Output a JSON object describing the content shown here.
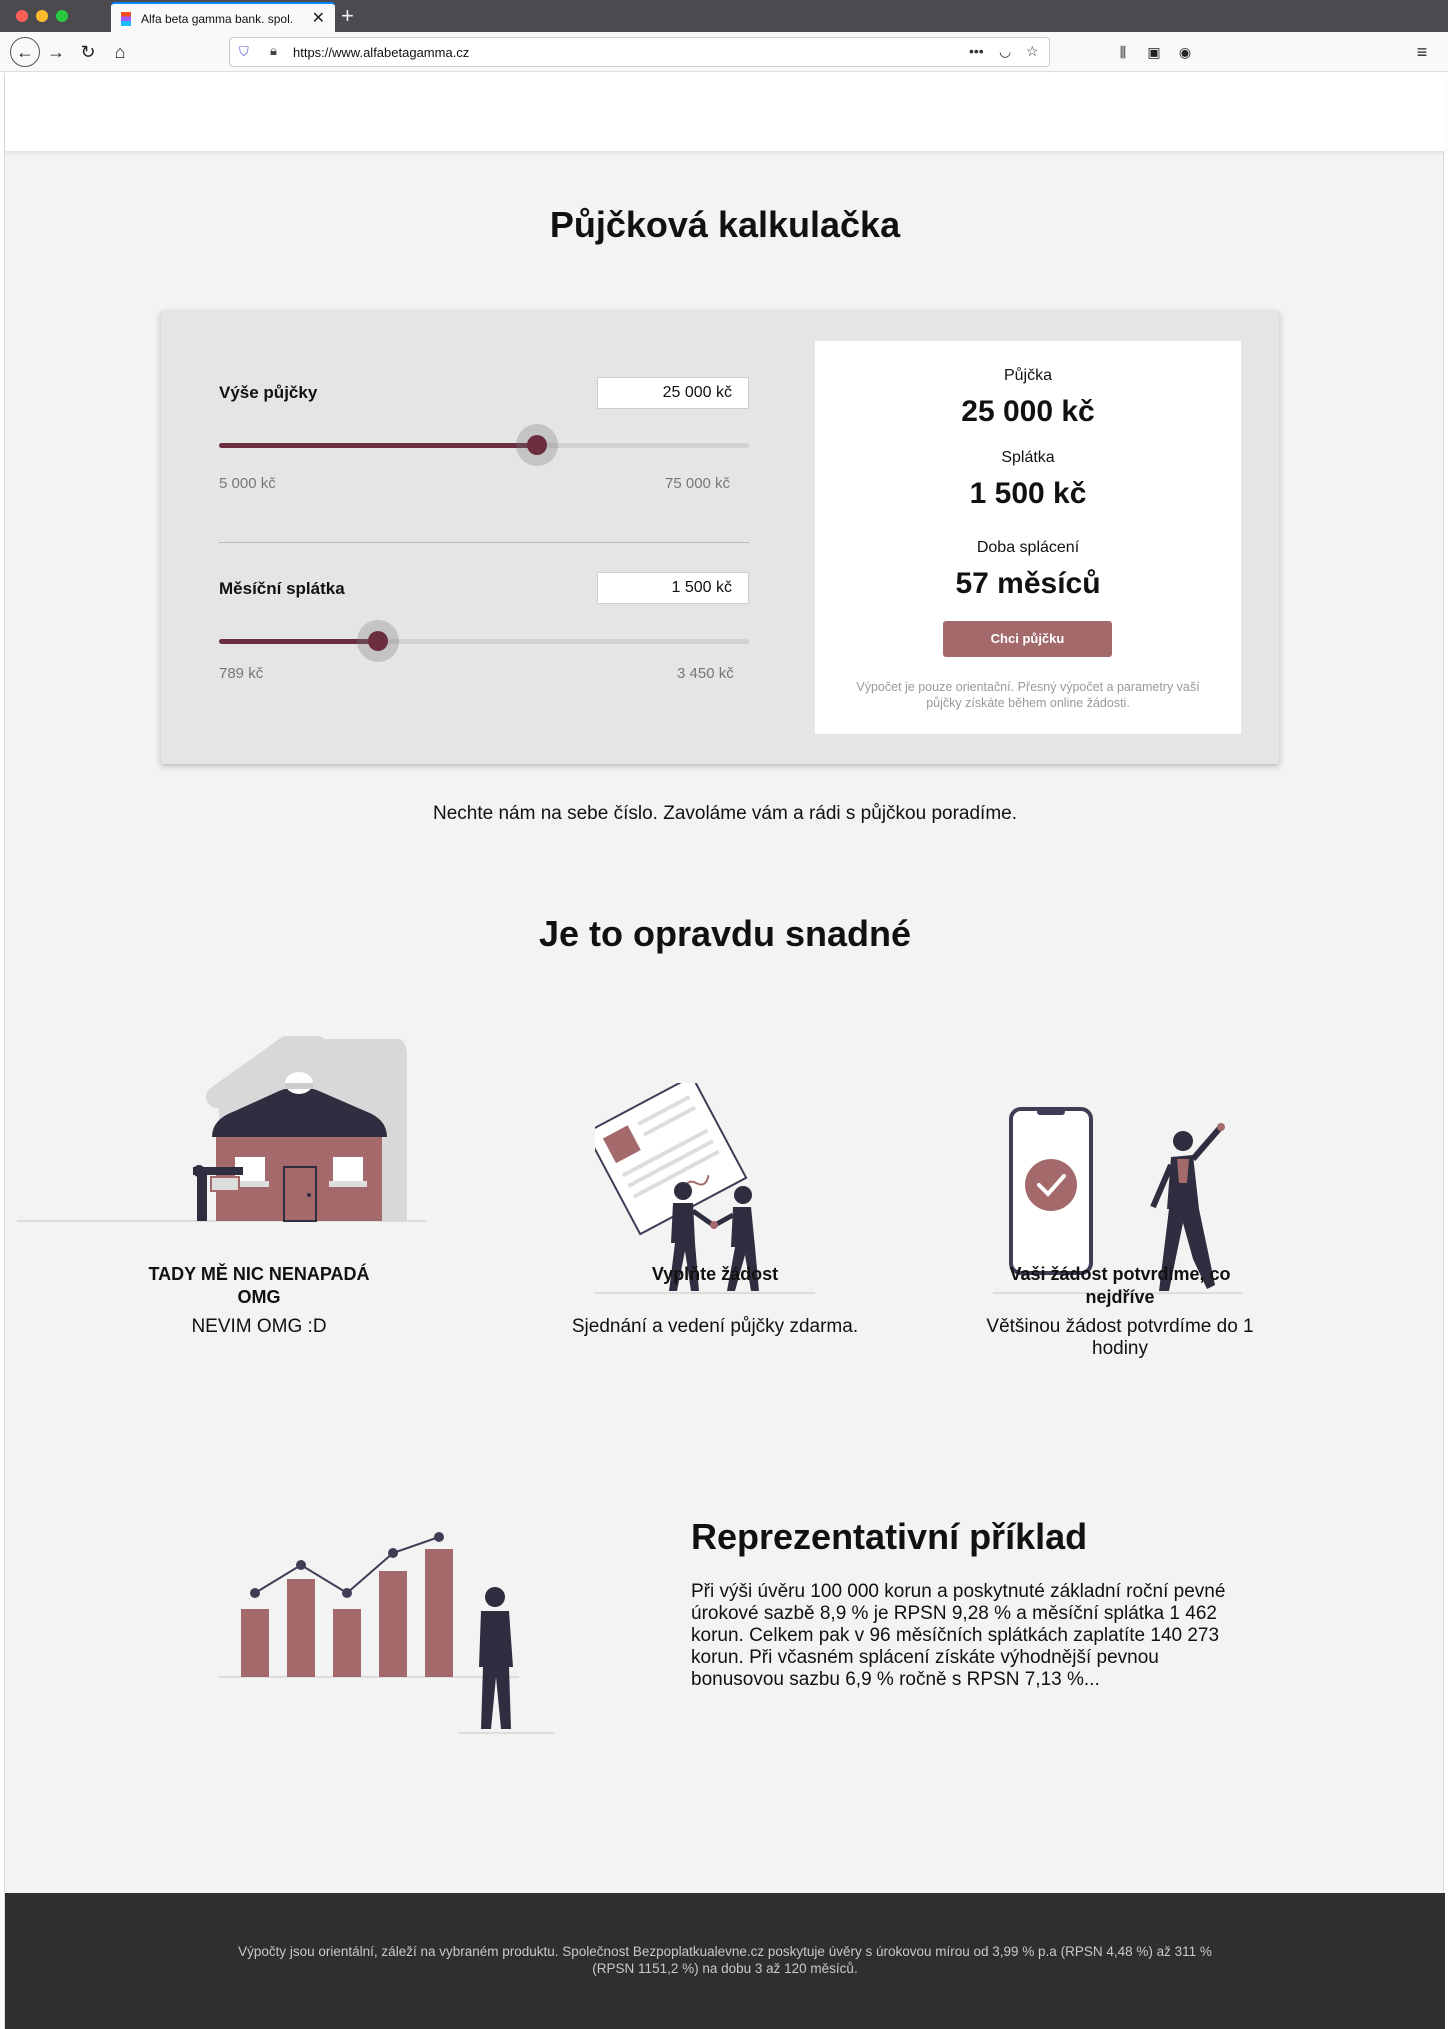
{
  "browser": {
    "tab_title": "Alfa beta gamma bank. spol.",
    "tab_close": "✕",
    "new_tab": "+",
    "url": "https://www.alfabetagamma.cz",
    "icons": [
      "back-icon",
      "forward-icon",
      "reload-icon",
      "home-icon",
      "tracking-shield-icon",
      "lock-icon",
      "page-actions-icon",
      "pocket-icon",
      "bookmark-star-icon",
      "library-icon",
      "sidebar-icon",
      "account-icon",
      "menu-icon"
    ]
  },
  "calculator": {
    "heading": "Půjčková kalkulačka",
    "amount": {
      "label": "Výše půjčky",
      "value": "25 000 kč",
      "min": "5 000 kč",
      "max": "75 000 kč",
      "level": 0.6
    },
    "payment": {
      "label": "Měsíční splátka",
      "value": "1 500 kč",
      "min": "789 kč",
      "max": "3 450 kč",
      "level": 0.3
    },
    "result": {
      "loan_label": "Půjčka",
      "loan_value": "25 000 kč",
      "payment_label": "Splátka",
      "payment_value": "1 500 kč",
      "duration_label": "Doba splácení",
      "duration_value": "57 měsíců",
      "cta": "Chci půjčku",
      "note": "Výpočet je pouze orientační. Přesný výpočet a parametry vaší půjčky získáte během online žádosti."
    },
    "callback_text": "Nechte nám na sebe číslo. Zavoláme vám a rádi s půjčkou poradíme."
  },
  "steps": {
    "heading": "Je to opravdu snadné",
    "items": [
      {
        "title": "TADY MĚ NIC NENAPADÁ OMG",
        "text": "NEVIM OMG :D"
      },
      {
        "title": "Vyplňte žádost",
        "text": "Sjednání a vedení půjčky zdarma."
      },
      {
        "title": "Vaši žádost potvrdíme, co nejdříve",
        "text": "Většinou žádost potvrdíme do 1 hodiny"
      }
    ]
  },
  "example": {
    "heading": "Reprezentativní příklad",
    "text": "Při výši úvěru 100 000 korun a poskytnuté základní roční pevné úrokové sazbě 8,9 % je RPSN 9,28 % a měsíční splátka 1 462 korun. Celkem pak v 96 měsíčních splátkách zaplatíte 140 273 korun. Při včasném splácení získáte výhodnější pevnou bonusovou sazbu 6,9 % ročně s RPSN 7,13 %..."
  },
  "footer": {
    "text": "Výpočty jsou orientální, záleží na vybraném produktu. Společnost Bezpoplatkualevne.cz poskytuje úvěry s úrokovou mírou od 3,99 % p.a (RPSN 4,48 %) až 311 % (RPSN 1151,2 %) na dobu 3 až 120 měsíců."
  },
  "colors": {
    "accent": "#6b2e3f",
    "button": "#a46a6b",
    "illustration": "#a46a6b",
    "dark": "#2f2e41",
    "footer": "#2d302d"
  }
}
